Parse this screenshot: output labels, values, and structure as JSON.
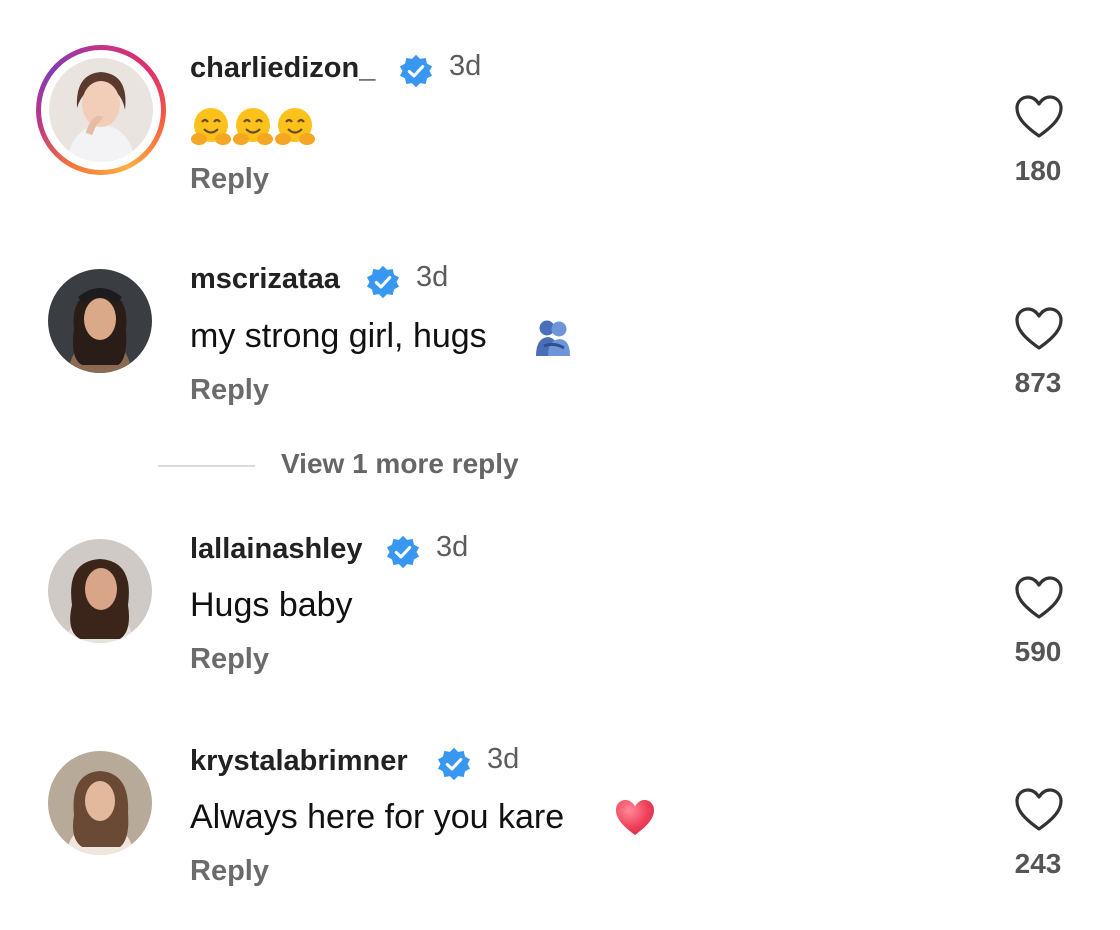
{
  "colors": {
    "verified_blue": "#3897f0",
    "story_ring": "#c13584",
    "reply_gray": "#6b6b6b"
  },
  "comments": [
    {
      "username": "charliedizon_",
      "time": "3d",
      "text": "",
      "emoji": "hugging-face x3",
      "reply": "Reply",
      "likes": "180",
      "verified": true,
      "has_story_ring": true
    },
    {
      "username": "mscrizataa",
      "time": "3d",
      "text": "my strong girl, hugs",
      "emoji": "people-hugging",
      "reply": "Reply",
      "likes": "873",
      "verified": true,
      "has_story_ring": false
    },
    {
      "username": "lallainashley",
      "time": "3d",
      "text": "Hugs baby",
      "emoji": "",
      "reply": "Reply",
      "likes": "590",
      "verified": true,
      "has_story_ring": false
    },
    {
      "username": "krystalabrimner",
      "time": "3d",
      "text": "Always here for you kare",
      "emoji": "red-heart",
      "reply": "Reply",
      "likes": "243",
      "verified": true,
      "has_story_ring": false
    }
  ],
  "view_more_replies": "View 1 more reply"
}
